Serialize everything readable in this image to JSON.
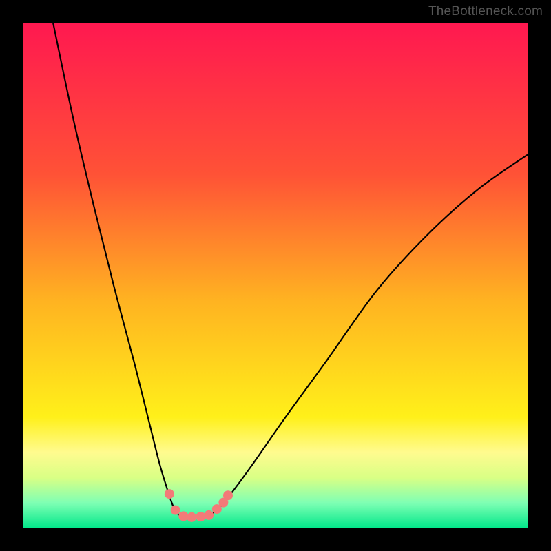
{
  "watermark": "TheBottleneck.com",
  "chart_data": {
    "type": "line",
    "title": "",
    "xlabel": "",
    "ylabel": "",
    "xlim": [
      0,
      100
    ],
    "ylim": [
      0,
      100
    ],
    "background": {
      "type": "vertical_gradient",
      "stops": [
        {
          "pos": 0.0,
          "color": "#ff1850"
        },
        {
          "pos": 0.3,
          "color": "#ff5236"
        },
        {
          "pos": 0.55,
          "color": "#ffb321"
        },
        {
          "pos": 0.78,
          "color": "#fff01a"
        },
        {
          "pos": 0.85,
          "color": "#fffb8f"
        },
        {
          "pos": 0.9,
          "color": "#d9ff85"
        },
        {
          "pos": 0.95,
          "color": "#7effb4"
        },
        {
          "pos": 1.0,
          "color": "#00e789"
        }
      ]
    },
    "series": [
      {
        "name": "left-branch",
        "x": [
          6,
          10,
          14,
          18,
          22,
          25,
          27,
          28.5,
          29.5,
          30.2,
          31.0
        ],
        "y": [
          100,
          81,
          64,
          48,
          33,
          21,
          13,
          8,
          5,
          3.4,
          2.6
        ]
      },
      {
        "name": "valley",
        "x": [
          31.0,
          32.0,
          33.0,
          34.0,
          35.5,
          37.0
        ],
        "y": [
          2.6,
          2.3,
          2.2,
          2.2,
          2.3,
          2.6
        ]
      },
      {
        "name": "right-branch",
        "x": [
          37.0,
          38.0,
          40.0,
          45.0,
          52.0,
          60.0,
          70.0,
          80.0,
          90.0,
          100.0
        ],
        "y": [
          2.6,
          3.3,
          5.3,
          12,
          22,
          33,
          47,
          58,
          67,
          74
        ]
      }
    ],
    "markers": {
      "name": "highlight-points",
      "color": "#f37a78",
      "radius_px": 7,
      "points": [
        {
          "x": 29.0,
          "y": 6.8
        },
        {
          "x": 30.2,
          "y": 3.6
        },
        {
          "x": 31.8,
          "y": 2.4
        },
        {
          "x": 33.4,
          "y": 2.2
        },
        {
          "x": 35.2,
          "y": 2.3
        },
        {
          "x": 36.8,
          "y": 2.6
        },
        {
          "x": 38.4,
          "y": 3.8
        },
        {
          "x": 39.7,
          "y": 5.1
        },
        {
          "x": 40.6,
          "y": 6.5
        }
      ]
    }
  }
}
